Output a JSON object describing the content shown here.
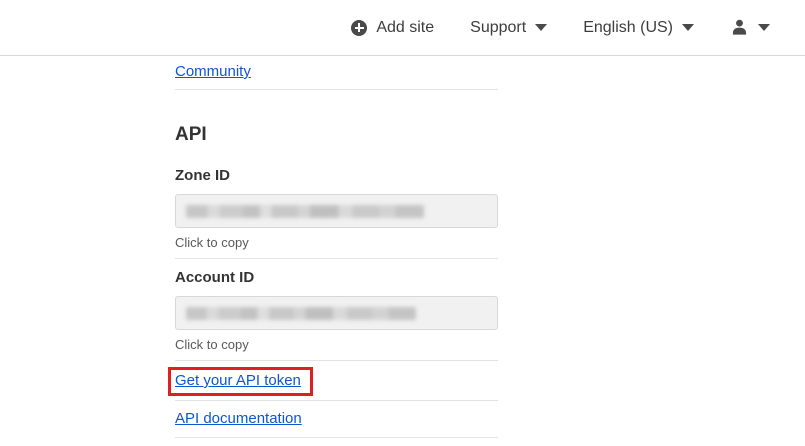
{
  "header": {
    "add_site_label": "Add site",
    "support_label": "Support",
    "language_label": "English (US)"
  },
  "content": {
    "community_link": "Community",
    "api_heading": "API",
    "zone_id": {
      "label": "Zone ID",
      "hint": "Click to copy",
      "value_redacted": true
    },
    "account_id": {
      "label": "Account ID",
      "hint": "Click to copy",
      "value_redacted": true
    },
    "get_token_link": "Get your API token",
    "api_docs_link": "API documentation"
  },
  "annotations": {
    "highlight_target": "Get your API token",
    "highlight_color": "#e02020"
  },
  "colors": {
    "link_blue": "#0b57cf",
    "header_text": "#3d3d3d",
    "heading_text": "#333333",
    "hint_text": "#595959",
    "divider": "#e3e3e3",
    "field_background": "#f1f1f1",
    "field_border": "#d8d8d8",
    "icon_gray": "#4a4a4a"
  }
}
